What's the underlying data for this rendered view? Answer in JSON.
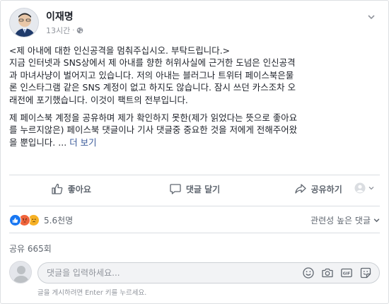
{
  "post": {
    "author": "이재명",
    "time": "13시간",
    "dot": "·",
    "body_lines": [
      "<제 아내에 대한 인신공격을 멈춰주십시오. 부탁드립니다.>",
      "지금 인터넷과 SNS상에서 제 아내를 향한 허위사실에 근거한 도넘은 인신공격",
      "과 마녀사냥이 벌어지고 있습니다. 저의 아내는 블러그나 트위터 페이스북은물",
      "론 인스타그램 같은 SNS 계정이 없고 하지도 않습니다. 잠시 쓰던 카스조차 오",
      "래전에 포기했습니다. 이것이 팩트의 전부입니다."
    ],
    "body_lines_2": [
      "제 페이스북 계정을 공유하며 제가 확인하지 못한(제가 읽었다는 뜻으로 좋아요",
      "를 누르지않은) 페이스북 댓글이나 기사 댓글중 중요한 것을 저에게 전해주어왔",
      "을 뿐입니다. ..."
    ],
    "see_more": "더 보기"
  },
  "actions": {
    "like": "좋아요",
    "comment": "댓글 달기",
    "share": "공유하기"
  },
  "reactions": {
    "count": "5.6천명",
    "sort_label": "관련성 높은 댓글"
  },
  "shares": "공유 665회",
  "composer": {
    "placeholder": "댓글을 입력하세요...",
    "hint": "글을 게시하려면 Enter 키를 누르세요."
  },
  "colors": {
    "like_blue": "#1877f2",
    "angry": "#f0643c",
    "sad": "#f7b125",
    "link": "#385898"
  },
  "icons": [
    "globe-icon",
    "chevron-down-icon",
    "like-icon",
    "comment-icon",
    "share-icon",
    "audience-icon",
    "emoji-icon",
    "camera-icon",
    "gif-icon",
    "sticker-icon"
  ]
}
